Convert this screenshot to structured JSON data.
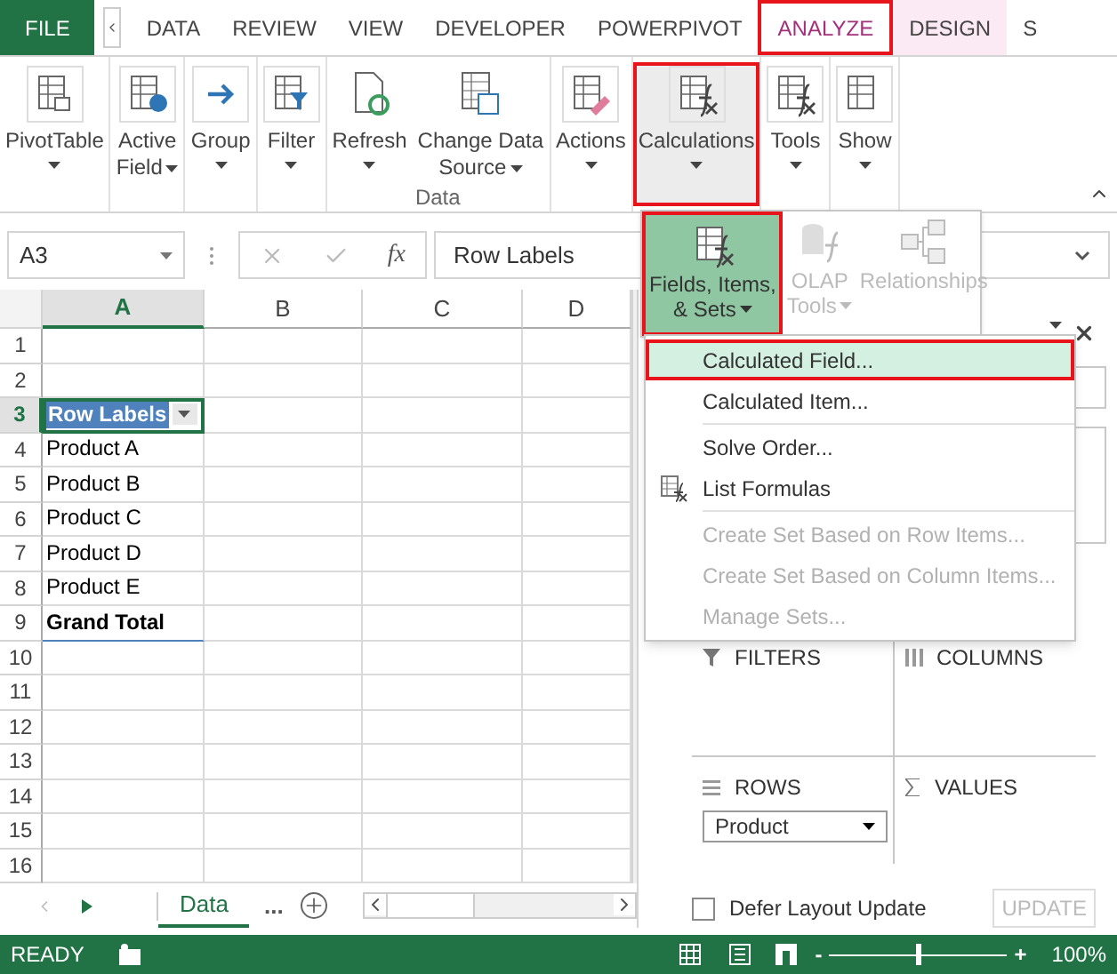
{
  "ribbon_tabs": [
    {
      "label": "FILE",
      "kind": "file",
      "selected": false
    },
    {
      "label": "DATA",
      "kind": "plain",
      "selected": false
    },
    {
      "label": "REVIEW",
      "kind": "plain",
      "selected": false
    },
    {
      "label": "VIEW",
      "kind": "plain",
      "selected": false
    },
    {
      "label": "DEVELOPER",
      "kind": "plain",
      "selected": false
    },
    {
      "label": "POWERPIVOT",
      "kind": "plain",
      "selected": false
    },
    {
      "label": "ANALYZE",
      "kind": "contextual",
      "selected": true
    },
    {
      "label": "DESIGN",
      "kind": "contextual",
      "selected": false
    },
    {
      "label": "S",
      "kind": "plain",
      "selected": false
    }
  ],
  "ribbon_groups": [
    {
      "commands": [
        {
          "lines": [
            "PivotTable"
          ],
          "highlighted": false
        }
      ]
    },
    {
      "commands": [
        {
          "lines": [
            "Active",
            "Field"
          ],
          "highlighted": false
        }
      ]
    },
    {
      "commands": [
        {
          "lines": [
            "Group"
          ],
          "highlighted": false
        }
      ]
    },
    {
      "commands": [
        {
          "lines": [
            "Filter"
          ],
          "highlighted": false
        }
      ]
    },
    {
      "label": "Data",
      "commands": [
        {
          "lines": [
            "Refresh"
          ],
          "highlighted": false
        },
        {
          "lines": [
            "Change Data",
            "Source"
          ],
          "highlighted": false
        }
      ]
    },
    {
      "commands": [
        {
          "lines": [
            "Actions"
          ],
          "highlighted": false
        }
      ]
    },
    {
      "commands": [
        {
          "lines": [
            "Calculations"
          ],
          "highlighted": true
        }
      ]
    },
    {
      "commands": [
        {
          "lines": [
            "Tools"
          ],
          "highlighted": false
        }
      ]
    },
    {
      "commands": [
        {
          "lines": [
            "Show"
          ],
          "highlighted": false
        }
      ]
    }
  ],
  "formula_bar": {
    "name_box": "A3",
    "function_label": "fx",
    "formula": "Row Labels"
  },
  "sheet": {
    "columns": [
      {
        "label": "A",
        "selected": true
      },
      {
        "label": "B",
        "selected": false
      },
      {
        "label": "C",
        "selected": false
      },
      {
        "label": "D",
        "selected": false
      }
    ],
    "rows": [
      {
        "number": "1",
        "kind": "empty",
        "selected": false
      },
      {
        "number": "2",
        "kind": "empty",
        "selected": false
      },
      {
        "number": "3",
        "kind": "header",
        "selected": true,
        "value": "Row Labels"
      },
      {
        "number": "4",
        "kind": "item",
        "selected": false,
        "value": "Product A"
      },
      {
        "number": "5",
        "kind": "item",
        "selected": false,
        "value": "Product B"
      },
      {
        "number": "6",
        "kind": "item",
        "selected": false,
        "value": "Product C"
      },
      {
        "number": "7",
        "kind": "item",
        "selected": false,
        "value": "Product D"
      },
      {
        "number": "8",
        "kind": "item",
        "selected": false,
        "value": "Product E"
      },
      {
        "number": "9",
        "kind": "total",
        "selected": false,
        "value": "Grand Total"
      },
      {
        "number": "10",
        "kind": "empty",
        "selected": false
      },
      {
        "number": "11",
        "kind": "empty",
        "selected": false
      },
      {
        "number": "12",
        "kind": "empty",
        "selected": false
      },
      {
        "number": "13",
        "kind": "empty",
        "selected": false
      },
      {
        "number": "14",
        "kind": "empty",
        "selected": false
      },
      {
        "number": "15",
        "kind": "empty",
        "selected": false
      },
      {
        "number": "16",
        "kind": "empty",
        "selected": false
      }
    ]
  },
  "sheet_tabs": {
    "tabs": [
      {
        "label": "Data",
        "selected": true
      }
    ],
    "more": "..."
  },
  "pivot_pane": {
    "areas": [
      {
        "label": "FILTERS"
      },
      {
        "label": "COLUMNS"
      },
      {
        "label": "ROWS",
        "field": "Product"
      },
      {
        "label": "VALUES"
      }
    ],
    "defer": {
      "label": "Defer Layout Update",
      "checked": false
    },
    "update_button": {
      "label": "UPDATE",
      "disabled": true
    }
  },
  "calculations_menu": {
    "gallery": [
      {
        "lines": [
          "Fields, Items,",
          "& Sets"
        ],
        "has_menu": true,
        "selected": true,
        "disabled": false
      },
      {
        "lines": [
          "OLAP",
          "Tools"
        ],
        "has_menu": true,
        "selected": false,
        "disabled": true
      },
      {
        "lines": [
          "Relationships"
        ],
        "has_menu": false,
        "selected": false,
        "disabled": true
      }
    ],
    "items": [
      {
        "label": "Calculated Field...",
        "highlighted": true,
        "disabled": false,
        "separator_before": false,
        "icon": false
      },
      {
        "label": "Calculated Item...",
        "highlighted": false,
        "disabled": false,
        "separator_before": false,
        "icon": false
      },
      {
        "label": "Solve Order...",
        "highlighted": false,
        "disabled": false,
        "separator_before": true,
        "icon": false
      },
      {
        "label": "List Formulas",
        "highlighted": false,
        "disabled": false,
        "separator_before": false,
        "icon": true
      },
      {
        "label": "Create Set Based on Row Items...",
        "highlighted": false,
        "disabled": true,
        "separator_before": true,
        "icon": false
      },
      {
        "label": "Create Set Based on Column Items...",
        "highlighted": false,
        "disabled": true,
        "separator_before": false,
        "icon": false
      },
      {
        "label": "Manage Sets...",
        "highlighted": false,
        "disabled": true,
        "separator_before": false,
        "icon": false
      }
    ]
  },
  "status_bar": {
    "status": "READY",
    "zoom_out": "-",
    "zoom_in": "+",
    "zoom": {
      "level": 0.5
    },
    "zoom_label": "100%"
  }
}
